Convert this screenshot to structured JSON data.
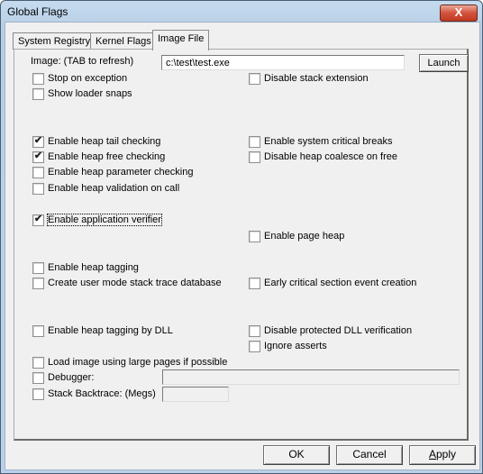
{
  "window": {
    "title": "Global Flags",
    "close_label": "X"
  },
  "tabs": [
    {
      "label": "System Registry",
      "active": false
    },
    {
      "label": "Kernel Flags",
      "active": false
    },
    {
      "label": "Image File",
      "active": true
    }
  ],
  "image": {
    "label": "Image: (TAB to refresh)",
    "value": "c:\\test\\test.exe",
    "launch_label": "Launch"
  },
  "checkboxes": {
    "stop_on_exception": {
      "label": "Stop on exception",
      "checked": false
    },
    "show_loader_snaps": {
      "label": "Show loader snaps",
      "checked": false
    },
    "disable_stack_extension": {
      "label": "Disable stack extension",
      "checked": false
    },
    "heap_tail_checking": {
      "label": "Enable heap tail checking",
      "checked": true
    },
    "heap_free_checking": {
      "label": "Enable heap free checking",
      "checked": true
    },
    "heap_parameter_checking": {
      "label": "Enable heap parameter checking",
      "checked": false
    },
    "heap_validation_on_call": {
      "label": "Enable heap validation on call",
      "checked": false
    },
    "system_critical_breaks": {
      "label": "Enable system critical breaks",
      "checked": false
    },
    "disable_heap_coalesce": {
      "label": "Disable heap coalesce on free",
      "checked": false
    },
    "application_verifier": {
      "label": "Enable application verifier",
      "checked": true
    },
    "page_heap": {
      "label": "Enable page heap",
      "checked": false
    },
    "heap_tagging": {
      "label": "Enable heap tagging",
      "checked": false
    },
    "user_mode_stack_trace": {
      "label": "Create user mode stack trace database",
      "checked": false
    },
    "early_critical_section": {
      "label": "Early critical section event creation",
      "checked": false
    },
    "heap_tagging_by_dll": {
      "label": "Enable heap tagging by DLL",
      "checked": false
    },
    "disable_protected_dll": {
      "label": "Disable protected DLL verification",
      "checked": false
    },
    "ignore_asserts": {
      "label": "Ignore asserts",
      "checked": false
    },
    "large_pages": {
      "label": "Load image using large pages if possible",
      "checked": false
    },
    "debugger": {
      "label": "Debugger:",
      "checked": false,
      "value": ""
    },
    "stack_backtrace": {
      "label": "Stack Backtrace: (Megs)",
      "checked": false,
      "value": ""
    }
  },
  "check_glyph": "✔",
  "footer": {
    "ok_label": "OK",
    "cancel_label": "Cancel",
    "apply_label": "Apply"
  }
}
